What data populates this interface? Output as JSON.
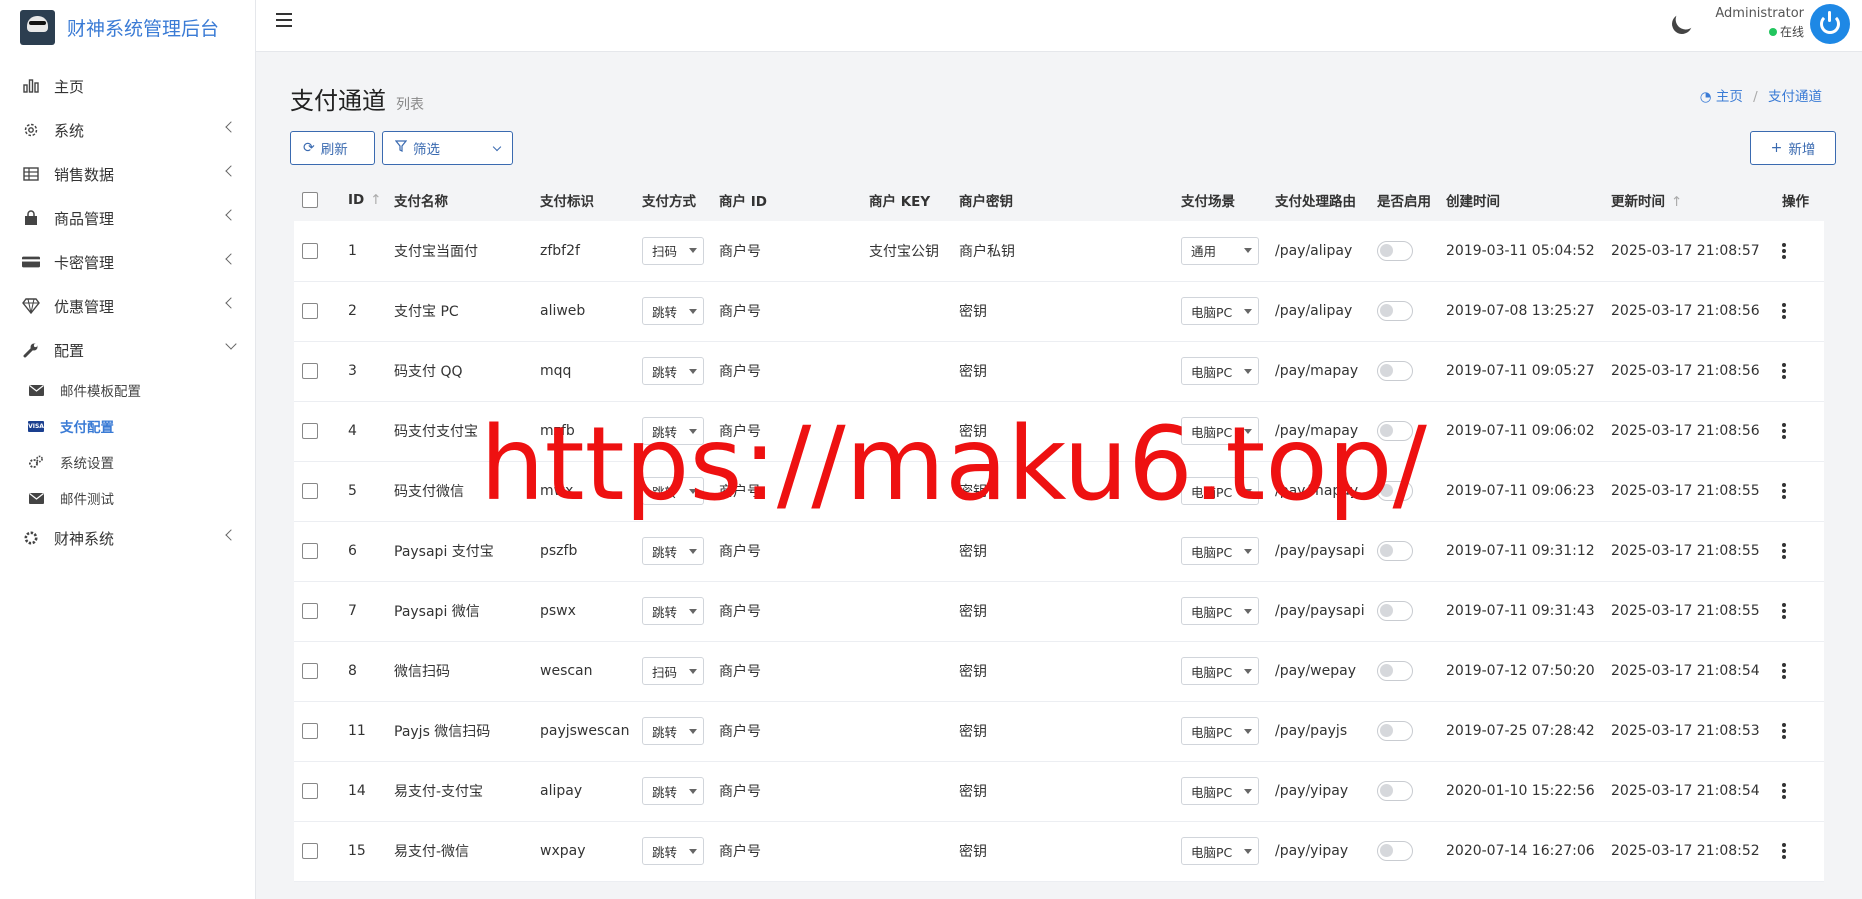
{
  "brand": {
    "title": "财神系统管理后台"
  },
  "sidebar": {
    "items": [
      {
        "label": "主页",
        "icon": "bar-chart-icon"
      },
      {
        "label": "系统",
        "icon": "gear-icon"
      },
      {
        "label": "销售数据",
        "icon": "table-icon"
      },
      {
        "label": "商品管理",
        "icon": "shopping-bag-icon"
      },
      {
        "label": "卡密管理",
        "icon": "credit-card-icon"
      },
      {
        "label": "优惠管理",
        "icon": "diamond-icon"
      },
      {
        "label": "配置",
        "icon": "wrench-icon"
      },
      {
        "label": "财神系统",
        "icon": "gear-icon"
      }
    ],
    "sub_items": [
      {
        "label": "邮件模板配置",
        "icon": "envelope-icon"
      },
      {
        "label": "支付配置",
        "icon": "visa-card-icon"
      },
      {
        "label": "系统设置",
        "icon": "gears-icon"
      },
      {
        "label": "邮件测试",
        "icon": "envelope-icon"
      }
    ]
  },
  "topbar": {
    "user_name": "Administrator",
    "user_status": "在线"
  },
  "page": {
    "title": "支付通道",
    "subtitle": "列表",
    "breadcrumb": {
      "home": "主页",
      "current": "支付通道"
    }
  },
  "toolbar": {
    "refresh_label": "刷新",
    "filter_label": "筛选",
    "add_label": "新增"
  },
  "table": {
    "columns": [
      "ID",
      "支付名称",
      "支付标识",
      "支付方式",
      "商户 ID",
      "商户 KEY",
      "商户密钥",
      "支付场景",
      "支付处理路由",
      "是否启用",
      "创建时间",
      "更新时间",
      "操作"
    ],
    "rows": [
      {
        "id": "1",
        "name": "支付宝当面付",
        "code": "zfbf2f",
        "method": "扫码",
        "merchant_id": "商户号",
        "merchant_key": "支付宝公钥",
        "secret": "商户私钥",
        "scene": "通用",
        "route": "/pay/alipay",
        "enabled": false,
        "created": "2019-03-11 05:04:52",
        "updated": "2025-03-17 21:08:57"
      },
      {
        "id": "2",
        "name": "支付宝 PC",
        "code": "aliweb",
        "method": "跳转",
        "merchant_id": "商户号",
        "merchant_key": "",
        "secret": "密钥",
        "scene": "电脑PC",
        "route": "/pay/alipay",
        "enabled": false,
        "created": "2019-07-08 13:25:27",
        "updated": "2025-03-17 21:08:56"
      },
      {
        "id": "3",
        "name": "码支付 QQ",
        "code": "mqq",
        "method": "跳转",
        "merchant_id": "商户号",
        "merchant_key": "",
        "secret": "密钥",
        "scene": "电脑PC",
        "route": "/pay/mapay",
        "enabled": false,
        "created": "2019-07-11 09:05:27",
        "updated": "2025-03-17 21:08:56"
      },
      {
        "id": "4",
        "name": "码支付支付宝",
        "code": "mzfb",
        "method": "跳转",
        "merchant_id": "商户号",
        "merchant_key": "",
        "secret": "密钥",
        "scene": "电脑PC",
        "route": "/pay/mapay",
        "enabled": false,
        "created": "2019-07-11 09:06:02",
        "updated": "2025-03-17 21:08:56"
      },
      {
        "id": "5",
        "name": "码支付微信",
        "code": "mwx",
        "method": "跳转",
        "merchant_id": "商户号",
        "merchant_key": "",
        "secret": "密钥",
        "scene": "电脑PC",
        "route": "/pay/mapay",
        "enabled": false,
        "created": "2019-07-11 09:06:23",
        "updated": "2025-03-17 21:08:55"
      },
      {
        "id": "6",
        "name": "Paysapi 支付宝",
        "code": "pszfb",
        "method": "跳转",
        "merchant_id": "商户号",
        "merchant_key": "",
        "secret": "密钥",
        "scene": "电脑PC",
        "route": "/pay/paysapi",
        "enabled": false,
        "created": "2019-07-11 09:31:12",
        "updated": "2025-03-17 21:08:55"
      },
      {
        "id": "7",
        "name": "Paysapi 微信",
        "code": "pswx",
        "method": "跳转",
        "merchant_id": "商户号",
        "merchant_key": "",
        "secret": "密钥",
        "scene": "电脑PC",
        "route": "/pay/paysapi",
        "enabled": false,
        "created": "2019-07-11 09:31:43",
        "updated": "2025-03-17 21:08:55"
      },
      {
        "id": "8",
        "name": "微信扫码",
        "code": "wescan",
        "method": "扫码",
        "merchant_id": "商户号",
        "merchant_key": "",
        "secret": "密钥",
        "scene": "电脑PC",
        "route": "/pay/wepay",
        "enabled": false,
        "created": "2019-07-12 07:50:20",
        "updated": "2025-03-17 21:08:54"
      },
      {
        "id": "11",
        "name": "Payjs 微信扫码",
        "code": "payjswescan",
        "method": "跳转",
        "merchant_id": "商户号",
        "merchant_key": "",
        "secret": "密钥",
        "scene": "电脑PC",
        "route": "/pay/payjs",
        "enabled": false,
        "created": "2019-07-25 07:28:42",
        "updated": "2025-03-17 21:08:53"
      },
      {
        "id": "14",
        "name": "易支付-支付宝",
        "code": "alipay",
        "method": "跳转",
        "merchant_id": "商户号",
        "merchant_key": "",
        "secret": "密钥",
        "scene": "电脑PC",
        "route": "/pay/yipay",
        "enabled": false,
        "created": "2020-01-10 15:22:56",
        "updated": "2025-03-17 21:08:54"
      },
      {
        "id": "15",
        "name": "易支付-微信",
        "code": "wxpay",
        "method": "跳转",
        "merchant_id": "商户号",
        "merchant_key": "",
        "secret": "密钥",
        "scene": "电脑PC",
        "route": "/pay/yipay",
        "enabled": false,
        "created": "2020-07-14 16:27:06",
        "updated": "2025-03-17 21:08:52"
      }
    ]
  },
  "watermark": {
    "text": "https://maku6.top/"
  },
  "colors": {
    "accent": "#3a7bd5",
    "watermark": "#ee1111",
    "online": "#22c55e"
  }
}
